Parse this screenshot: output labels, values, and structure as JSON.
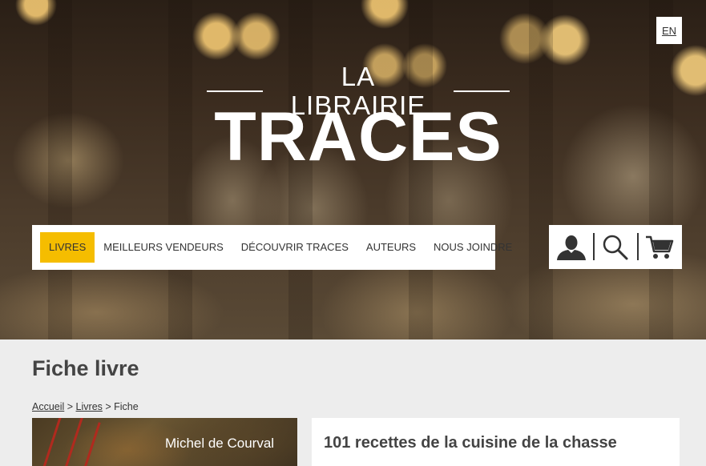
{
  "header": {
    "lang_toggle": "EN",
    "logo_small": "LA LIBRAIRIE",
    "logo_big": "TRACES"
  },
  "nav": {
    "items": [
      {
        "label": "LIVRES",
        "active": true
      },
      {
        "label": "MEILLEURS VENDEURS",
        "active": false
      },
      {
        "label": "DÉCOUVRIR TRACES",
        "active": false
      },
      {
        "label": "AUTEURS",
        "active": false
      },
      {
        "label": "NOUS JOINDRE",
        "active": false
      }
    ],
    "tools": [
      "user-icon",
      "search-icon",
      "cart-icon"
    ],
    "accent_color": "#f5bd00"
  },
  "main": {
    "page_title": "Fiche livre",
    "breadcrumb": {
      "home": "Accueil",
      "sep1": " > ",
      "books": "Livres",
      "sep2": " > ",
      "current": "Fiche"
    },
    "book": {
      "cover_author": "Michel de Courval",
      "title": "101 recettes de la cuisine de la chasse"
    }
  }
}
